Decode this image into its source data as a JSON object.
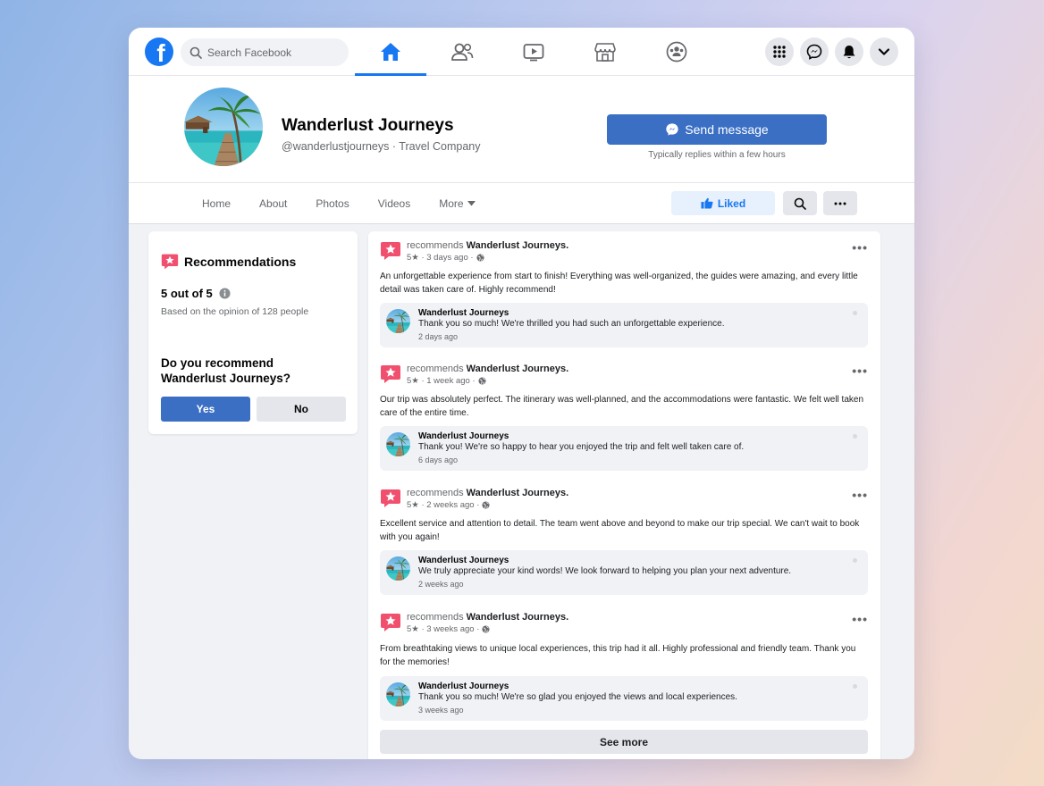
{
  "topnav": {
    "logo_letter": "f",
    "search_placeholder": "Search Facebook",
    "tabs": [
      "home-icon",
      "friends-icon",
      "video-icon",
      "marketplace-icon",
      "groups-icon"
    ],
    "active_tab": "home-icon",
    "right_buttons": [
      "menu-grid-icon",
      "messenger-icon",
      "bell-icon",
      "chevron-down-icon"
    ]
  },
  "profile": {
    "name": "Wanderlust Journeys",
    "subtitle": "@wanderlustjourneys · Travel Company",
    "send_message_label": "Send message",
    "reply_note": "Typically replies within a few hours"
  },
  "subnav": {
    "tabs": [
      "Home",
      "About",
      "Photos",
      "Videos",
      "More"
    ],
    "liked_label": "Liked"
  },
  "recommendations": {
    "title": "Recommendations",
    "score": "5 out of 5",
    "basis": "Based on the opinion of 128 people",
    "question": "Do you recommend Wanderlust Journeys?",
    "yes_label": "Yes",
    "no_label": "No"
  },
  "posts": [
    {
      "prefix": "recommends",
      "page": "Wanderlust Journeys.",
      "meta": "5★ · 3 days ago ·",
      "body": "An unforgettable experience from start to finish! Everything was well-organized, the guides were amazing, and every little detail was taken care of. Highly recommend!",
      "reply_name": "Wanderlust Journeys",
      "reply_text": "Thank you so much! We're thrilled you had such an unforgettable experience.",
      "reply_time": "2 days ago"
    },
    {
      "prefix": "recommends",
      "page": "Wanderlust Journeys.",
      "meta": "5★ · 1 week ago ·",
      "body": "Our trip was absolutely perfect. The itinerary was well-planned, and the accommodations were fantastic. We felt well taken care of the entire time.",
      "reply_name": "Wanderlust Journeys",
      "reply_text": "Thank you! We're so happy to hear you enjoyed the trip and felt well taken care of.",
      "reply_time": "6 days ago"
    },
    {
      "prefix": "recommends",
      "page": "Wanderlust Journeys.",
      "meta": "5★ · 2 weeks ago ·",
      "body": "Excellent service and attention to detail. The team went above and beyond to make our trip special. We can't wait to book with you again!",
      "reply_name": "Wanderlust Journeys",
      "reply_text": "We truly appreciate your kind words! We look forward to helping you plan your next adventure.",
      "reply_time": "2 weeks ago"
    },
    {
      "prefix": "recommends",
      "page": "Wanderlust Journeys.",
      "meta": "5★ · 3 weeks ago ·",
      "body": "From breathtaking views to unique local experiences, this trip had it all. Highly professional and friendly team. Thank you for the memories!",
      "reply_name": "Wanderlust Journeys",
      "reply_text": "Thank you so much! We're so glad you enjoyed the views and local experiences.",
      "reply_time": "3 weeks ago"
    }
  ],
  "see_more_label": "See more",
  "colors": {
    "brand": "#1877f2",
    "button_blue": "#3a6fc4",
    "recommend_badge": "#f0506e"
  }
}
